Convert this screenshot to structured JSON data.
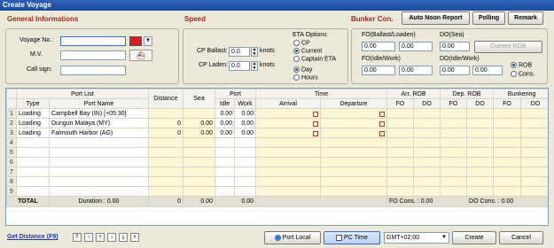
{
  "window": {
    "title": "Create Voyage"
  },
  "sections": {
    "general": "General Informations",
    "speed": "Speed",
    "bunker": "Bunker Con."
  },
  "buttons": {
    "auto_noon": "Auto Noon Report",
    "polling": "Polling",
    "remark": "Remark",
    "current_rob": "Current ROB",
    "port_local": "Port Local",
    "pc_time": "PC Time",
    "create": "Create",
    "cancel": "Cancel"
  },
  "general": {
    "voyage_label": "Voyage No.:",
    "voyage_value": "",
    "voyage_color": "#d71d1d",
    "mv_label": "M.V.",
    "mv_value": "",
    "callsign_label": "Call sign:",
    "callsign_value": ""
  },
  "speed": {
    "cp_ballast_label": "CP Ballast:",
    "cp_ballast_value": "0.0",
    "cp_ballast_unit": "knots",
    "cp_laden_label": "CP Laden:",
    "cp_laden_value": "0.0",
    "cp_laden_unit": "knots",
    "eta_title": "ETA Options",
    "eta_options": [
      "CP",
      "Current",
      "Captain ETA"
    ],
    "eta_selected": "Current",
    "unit_options": [
      "Day",
      "Hours"
    ],
    "unit_selected": "Day"
  },
  "bunker": {
    "fo_ballast_label": "FO(Ballast/Loaden)",
    "fo_ballast_1": "0.00",
    "fo_ballast_2": "0.00",
    "do_sea_label": "DO(Sea)",
    "do_sea_value": "0.00",
    "fo_idle_label": "FO(Idle/Work)",
    "fo_idle_1": "0.00",
    "fo_idle_2": "0.00",
    "do_idle_label": "DO(Idle/Work)",
    "do_idle_1": "0.00",
    "do_idle_2": "0.00",
    "rob_options": [
      "ROB",
      "Cons."
    ],
    "rob_selected": "ROB"
  },
  "grid": {
    "group_headers": [
      "Port List",
      "Distance",
      "Sea",
      "Port",
      "Time",
      "Arr. ROB",
      "Dep. ROB",
      "Bunkering"
    ],
    "sub_headers": [
      "Type",
      "Port Name",
      "Idle",
      "Work",
      "Arrival",
      "Departure",
      "FO",
      "DO",
      "FO",
      "DO",
      "FO",
      "DO"
    ],
    "rows": [
      {
        "n": "1",
        "type": "Loading",
        "port": "Campbell Bay (IN) [+05:30]",
        "distance": "",
        "sea": "",
        "idle": "0.00",
        "work": "0.00"
      },
      {
        "n": "2",
        "type": "Loading",
        "port": "Dungun Malaya (MY)",
        "distance": "0",
        "sea": "0.00",
        "idle": "0.00",
        "work": "0.00"
      },
      {
        "n": "3",
        "type": "Loading",
        "port": "Falmouth Harbor (AG)",
        "distance": "0",
        "sea": "0.00",
        "idle": "0.00",
        "work": "0.00"
      },
      {
        "n": "4"
      },
      {
        "n": "5"
      },
      {
        "n": "6"
      },
      {
        "n": "7"
      },
      {
        "n": "8"
      },
      {
        "n": "9"
      }
    ],
    "total": {
      "label": "TOTAL",
      "duration": "Duration : 0.00",
      "distance": "0",
      "sea": "0.00",
      "port": "0.00",
      "fo_cons": "FO Cons. : 0.00",
      "do_cons": "DO Cons. : 0.00"
    }
  },
  "footer": {
    "get_distance": "Get Distance (F9)",
    "timezone": "GMT+02:00"
  }
}
